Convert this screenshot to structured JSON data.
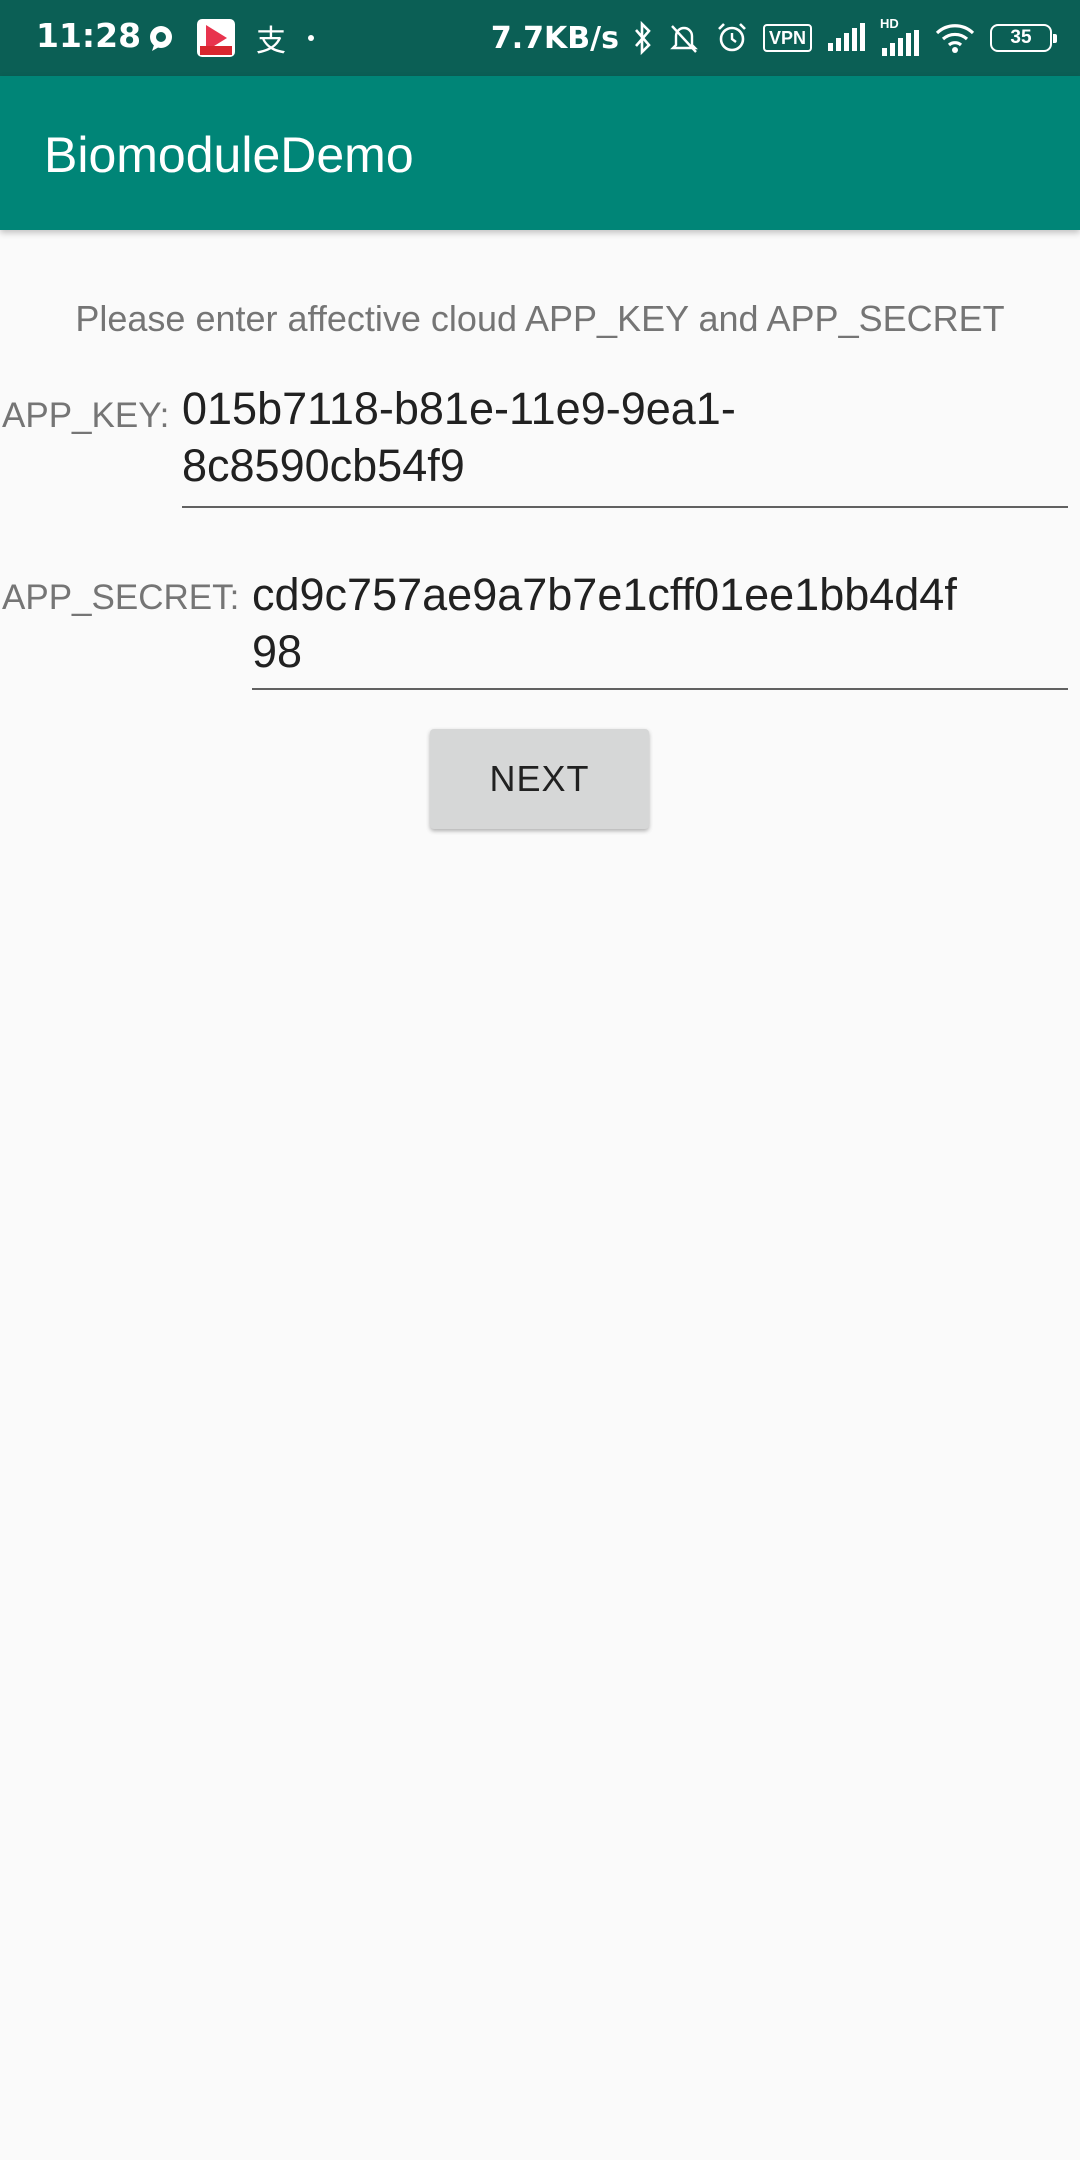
{
  "status_bar": {
    "time": "11:28",
    "net_speed": "7.7KB/s",
    "vpn": "VPN",
    "hd": "HD",
    "battery": "35",
    "alipay_glyph": "支",
    "icons": [
      "message-icon",
      "app-icon",
      "alipay-icon",
      "dot-icon",
      "bluetooth-icon",
      "mute-bell-icon",
      "alarm-icon",
      "signal-icon",
      "signal-hd-icon",
      "wifi-icon",
      "battery-icon"
    ]
  },
  "app_bar": {
    "title": "BiomoduleDemo",
    "color": "#008577"
  },
  "form": {
    "instruction": "Please enter affective cloud APP_KEY and APP_SECRET",
    "app_key_label": "APP_KEY:",
    "app_key_value_line1": "015b7118-b81e-11e9-9ea1-",
    "app_key_value_line2": "8c8590cb54f9",
    "app_secret_label": "APP_SECRET:",
    "app_secret_value_line1": "cd9c757ae9a7b7e1cff01ee1bb4d4f",
    "app_secret_value_line2": "98",
    "next_button": "NEXT"
  }
}
